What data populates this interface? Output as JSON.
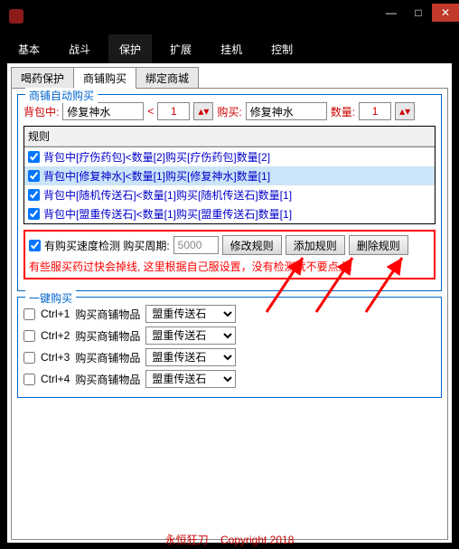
{
  "window": {
    "minimize": "—",
    "maximize": "□",
    "close": "✕"
  },
  "mainTabs": [
    "基本",
    "战斗",
    "保护",
    "扩展",
    "挂机",
    "控制"
  ],
  "mainActive": 2,
  "subTabs": [
    "喝药保护",
    "商铺购买",
    "绑定商城"
  ],
  "subActive": 1,
  "autobuy": {
    "legend": "商铺自动购买",
    "bagLabel": "背包中:",
    "bagItem": "修复神水",
    "lt": "<",
    "ltVal": "1",
    "buyLabel": "购买:",
    "buyItem": "修复神水",
    "qtyLabel": "数量:",
    "qtyVal": "1",
    "rulesHead": "规则",
    "rules": [
      "背包中[疗伤药包]<数量[2]购买[疗伤药包]数量[2]",
      "背包中[修复神水]<数量[1]购买[修复神水]数量[1]",
      "背包中[随机传送石]<数量[1]购买[随机传送石]数量[1]",
      "背包中[盟重传送石]<数量[1]购买[盟重传送石]数量[1]"
    ],
    "rulesSelected": 1
  },
  "speed": {
    "chkLabel": "有购买速度检测 购买周期:",
    "period": "5000",
    "btnEdit": "修改规则",
    "btnAdd": "添加规则",
    "btnDel": "删除规则",
    "warn": "有些服买药过快会掉线, 这里根据自己服设置，没有检测就不要点上."
  },
  "hotkey": {
    "legend": "一键购买",
    "rows": [
      {
        "key": "Ctrl+1",
        "text": "购买商铺物品",
        "item": "盟重传送石"
      },
      {
        "key": "Ctrl+2",
        "text": "购买商铺物品",
        "item": "盟重传送石"
      },
      {
        "key": "Ctrl+3",
        "text": "购买商铺物品",
        "item": "盟重传送石"
      },
      {
        "key": "Ctrl+4",
        "text": "购买商铺物品",
        "item": "盟重传送石"
      }
    ]
  },
  "footer": {
    "brand": "永恒狂刀",
    "copyright": "Copyright 2018"
  }
}
